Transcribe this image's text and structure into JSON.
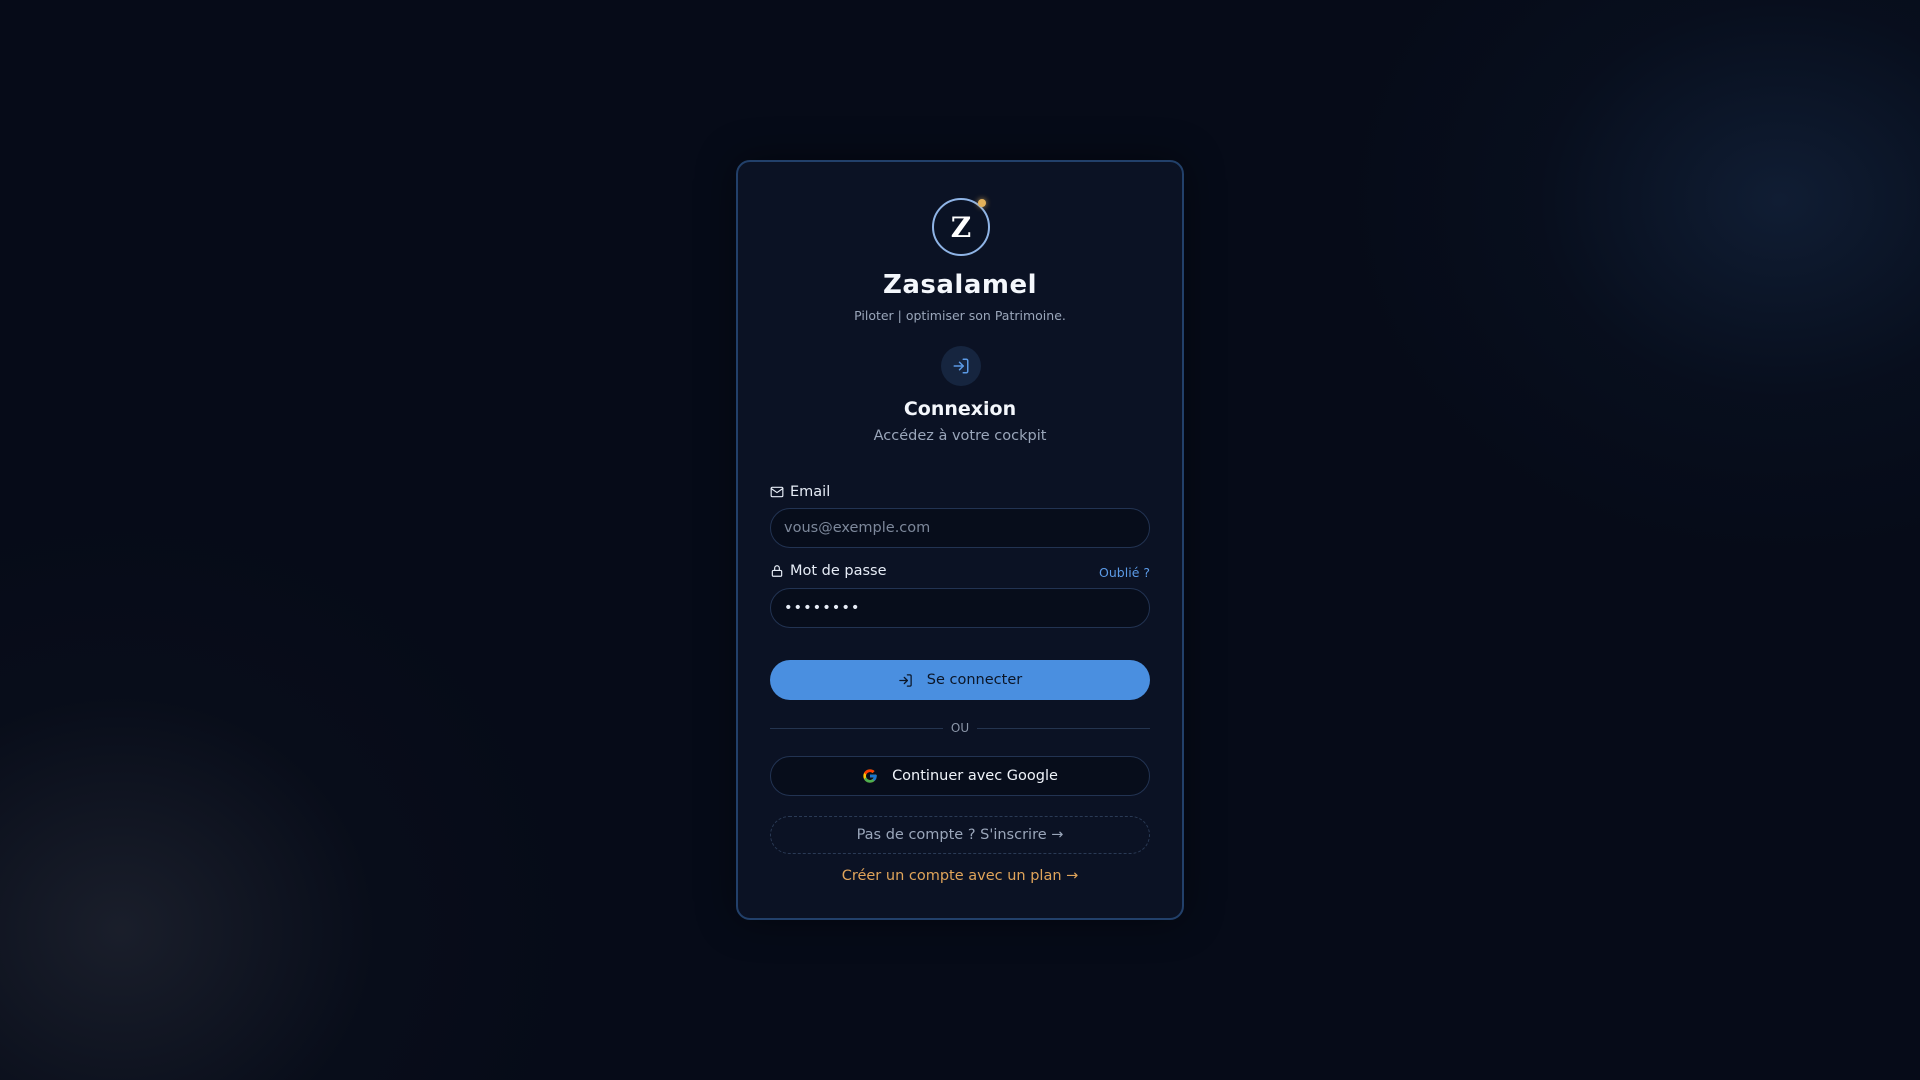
{
  "brand": {
    "logo_letter": "Z",
    "name": "Zasalamel",
    "tagline": "Piloter | optimiser son Patrimoine."
  },
  "form": {
    "title": "Connexion",
    "subtitle": "Accédez à votre cockpit",
    "email": {
      "label": "Email",
      "placeholder": "vous@exemple.com",
      "value": ""
    },
    "password": {
      "label": "Mot de passe",
      "value": "••••••••",
      "forgot_label": "Oublié ?"
    },
    "submit_label": "Se connecter",
    "divider_label": "OU",
    "google_label": "Continuer avec Google",
    "signup_label": "Pas de compte ? S'inscrire →",
    "plan_label": "Créer un compte avec un plan →"
  },
  "icons": {
    "email": "mail-icon",
    "password": "lock-icon",
    "login_badge": "login-icon",
    "submit": "login-icon",
    "google": "google-icon"
  },
  "colors": {
    "background": "#060b18",
    "card": "#0b1224",
    "card_border": "#22406a",
    "primary": "#4a8fe0",
    "link": "#5b9ae6",
    "accent": "#e0a45a",
    "logo_dot": "#e3b15a"
  }
}
